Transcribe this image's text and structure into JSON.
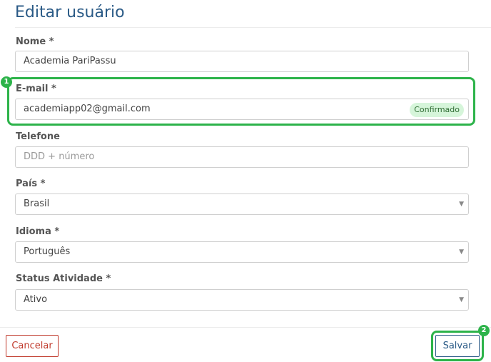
{
  "page_title": "Editar usuário",
  "form": {
    "name": {
      "label": "Nome *",
      "value": "Academia PariPassu"
    },
    "email": {
      "label": "E-mail *",
      "value": "academiapp02@gmail.com",
      "badge": "Confirmado"
    },
    "phone": {
      "label": "Telefone",
      "placeholder": "DDD + número"
    },
    "country": {
      "label": "País *",
      "value": "Brasil"
    },
    "language": {
      "label": "Idioma *",
      "value": "Português"
    },
    "status": {
      "label": "Status Atividade *",
      "value": "Ativo"
    }
  },
  "actions": {
    "cancel_label": "Cancelar",
    "save_label": "Salvar"
  },
  "markers": {
    "email_marker": "1",
    "save_marker": "2"
  },
  "colors": {
    "accent": "#2a5a86",
    "highlight": "#2db34a",
    "cancel": "#c0392b",
    "badge_bg": "#d6f5da"
  },
  "icons": {
    "select_caret": "chevron-down-icon"
  }
}
